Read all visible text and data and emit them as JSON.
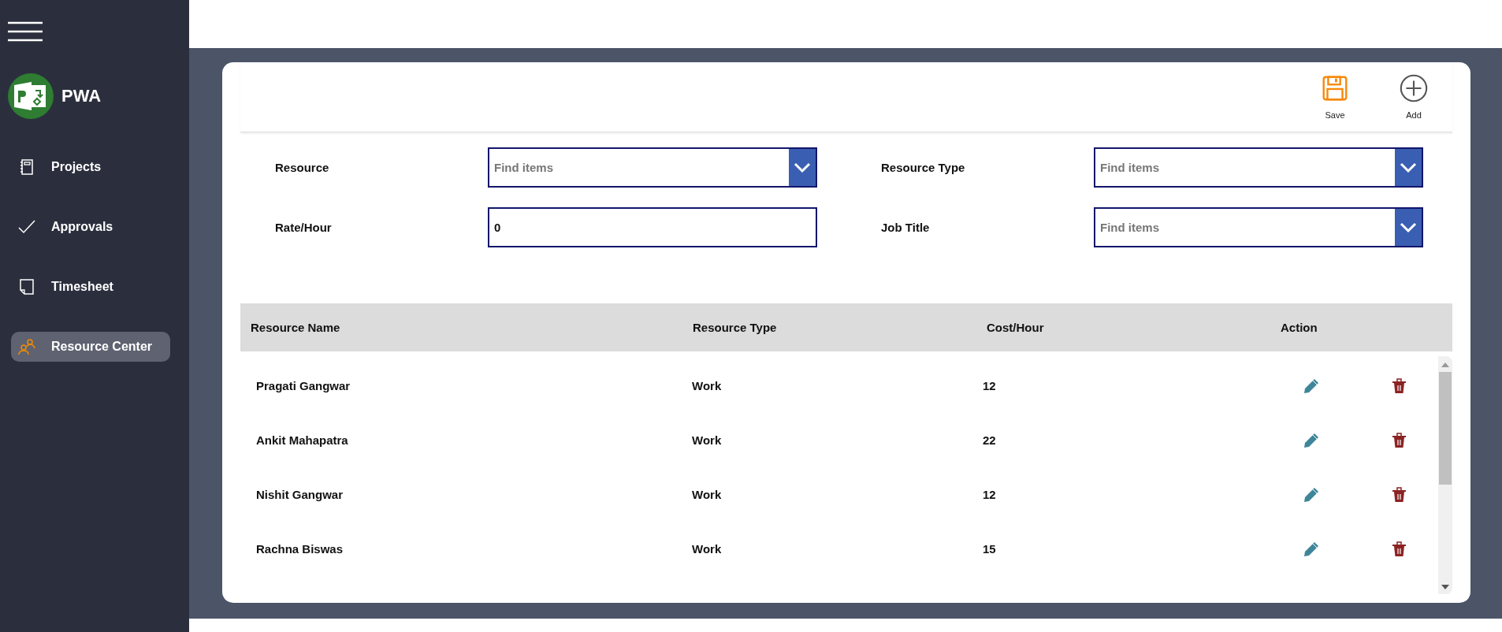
{
  "sidebar": {
    "title": "PWA",
    "items": [
      {
        "label": "Projects",
        "kind": "notebook",
        "selected": false
      },
      {
        "label": "Approvals",
        "kind": "check",
        "selected": false
      },
      {
        "label": "Timesheet",
        "kind": "sheet",
        "selected": false
      },
      {
        "label": "Resource Center",
        "kind": "people",
        "selected": true
      }
    ]
  },
  "toolbar": {
    "buttons": [
      {
        "label": "Save",
        "kind": "save"
      },
      {
        "label": "Add",
        "kind": "add"
      }
    ]
  },
  "form": {
    "fields": [
      {
        "label": "Resource",
        "kind": "dropdown",
        "placeholder": "Find items"
      },
      {
        "label": "Resource Type",
        "kind": "dropdown",
        "placeholder": "Find items"
      },
      {
        "label": "Rate/Hour",
        "kind": "text",
        "value": "0"
      },
      {
        "label": "Job Title",
        "kind": "dropdown",
        "placeholder": "Find items"
      }
    ]
  },
  "table": {
    "columns": [
      "Resource Name",
      "Resource Type",
      "Cost/Hour",
      "Action"
    ],
    "rows": [
      {
        "cells": [
          "Pragati Gangwar",
          "Work",
          "12"
        ]
      },
      {
        "cells": [
          "Ankit Mahapatra",
          "Work",
          "22"
        ]
      },
      {
        "cells": [
          "Nishit Gangwar",
          "Work",
          "12"
        ]
      },
      {
        "cells": [
          "Rachna Biswas",
          "Work",
          "15"
        ]
      }
    ]
  }
}
